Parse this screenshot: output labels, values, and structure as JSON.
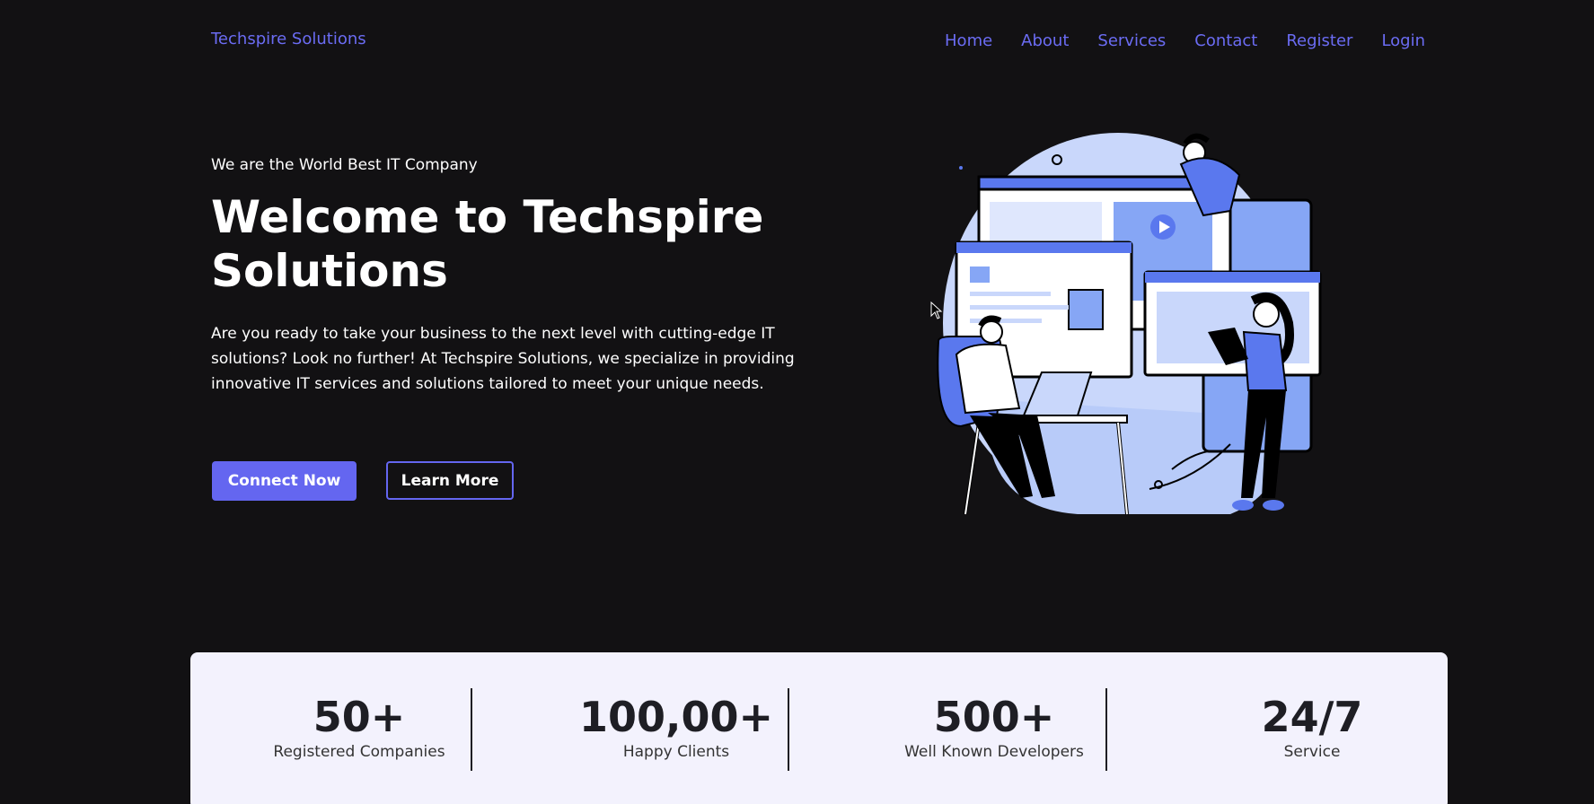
{
  "header": {
    "brand": "Techspire Solutions",
    "nav": [
      "Home",
      "About",
      "Services",
      "Contact",
      "Register",
      "Login"
    ]
  },
  "hero": {
    "tagline": "We are the World Best IT Company",
    "title": "Welcome to Techspire Solutions",
    "description": "Are you ready to take your business to the next level with cutting-edge IT solutions? Look no further! At Techspire Solutions, we specialize in providing innovative IT services and solutions tailored to meet your unique needs.",
    "primary_button": "Connect Now",
    "secondary_button": "Learn More"
  },
  "stats": [
    {
      "value": "50+",
      "label": "Registered Companies"
    },
    {
      "value": "100,00+",
      "label": "Happy Clients"
    },
    {
      "value": "500+",
      "label": "Well Known Developers"
    },
    {
      "value": "24/7",
      "label": "Service"
    }
  ],
  "colors": {
    "background": "#121113",
    "accent": "#6466f0",
    "stats_background": "#f3f2fd"
  }
}
